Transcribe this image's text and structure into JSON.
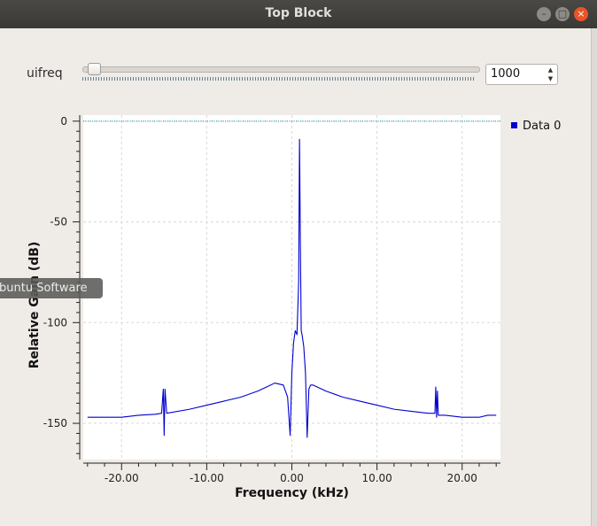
{
  "window": {
    "title": "Top Block",
    "minimize_glyph": "–",
    "maximize_glyph": "□",
    "close_glyph": "×"
  },
  "slider": {
    "label": "uifreq",
    "value": 1000,
    "min": 0,
    "max": 48000,
    "spin_value": "1000",
    "up_glyph": "▲",
    "down_glyph": "▼"
  },
  "overlay": {
    "text": "buntu Software"
  },
  "chart_data": {
    "type": "line",
    "title": "",
    "xlabel": "Frequency (kHz)",
    "ylabel": "Relative Gain (dB)",
    "xlim": [
      -24.5,
      24.5
    ],
    "ylim": [
      -168,
      3
    ],
    "xticks": [
      -20,
      -10,
      0,
      10,
      20
    ],
    "xtick_labels": [
      "-20.00",
      "-10.00",
      "0.00",
      "10.00",
      "20.00"
    ],
    "yticks": [
      0,
      -50,
      -100,
      -150
    ],
    "ytick_labels": [
      "0",
      "-50",
      "-100",
      "-150"
    ],
    "grid": true,
    "legend": "top-right",
    "series": [
      {
        "name": "Data 0",
        "color": "#0000d0",
        "x": [
          -24.0,
          -22.0,
          -20.0,
          -18.0,
          -16.0,
          -15.3,
          -15.1,
          -15.0,
          -14.9,
          -14.7,
          -12.0,
          -10.0,
          -8.0,
          -6.0,
          -4.0,
          -3.0,
          -2.0,
          -1.0,
          -0.5,
          -0.2,
          0.0,
          0.2,
          0.4,
          0.6,
          0.8,
          0.9,
          1.0,
          1.1,
          1.2,
          1.4,
          1.6,
          1.8,
          2.0,
          2.2,
          2.5,
          3.0,
          4.0,
          6.0,
          8.0,
          10.0,
          12.0,
          14.0,
          16.0,
          16.8,
          16.9,
          17.0,
          17.1,
          17.2,
          18.0,
          20.0,
          22.0,
          23.0,
          24.0
        ],
        "y": [
          -147,
          -147,
          -147,
          -146,
          -145.5,
          -145,
          -133,
          -156,
          -133,
          -145,
          -143,
          -141,
          -139,
          -137,
          -134,
          -132,
          -130,
          -131,
          -137,
          -156,
          -125,
          -110,
          -104,
          -106,
          -80,
          -9,
          -60,
          -104,
          -106,
          -112,
          -125,
          -157,
          -133,
          -131,
          -131,
          -132,
          -134,
          -137,
          -139,
          -141,
          -143,
          -144,
          -145,
          -145,
          -132,
          -147,
          -134,
          -146,
          -146,
          -147,
          -147,
          -146,
          -146
        ]
      }
    ],
    "reference_lines": [
      {
        "y": 0,
        "color": "#008b8b"
      }
    ]
  }
}
